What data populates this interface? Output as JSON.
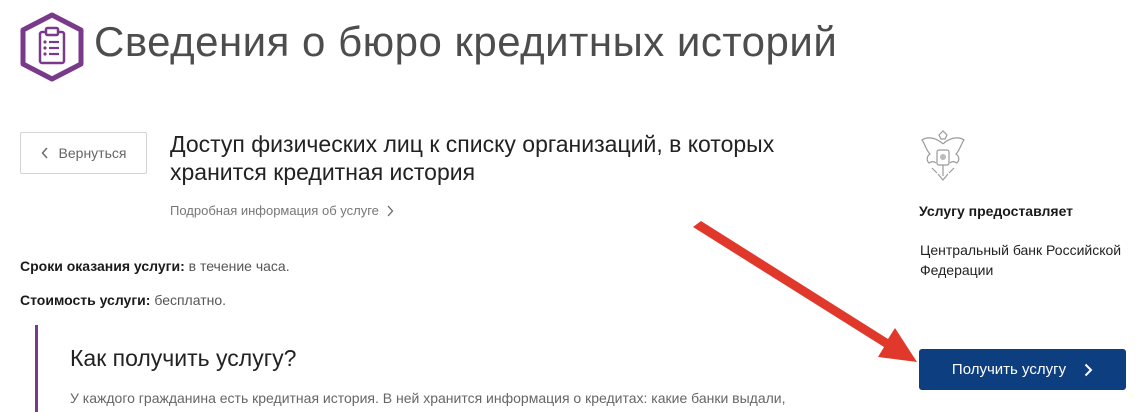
{
  "header": {
    "title": "Сведения о бюро кредитных историй",
    "icon": "clipboard-list-icon",
    "accent_color": "#7a3a8a"
  },
  "navigation": {
    "back_label": "Вернуться"
  },
  "service": {
    "title": "Доступ физических лиц к списку организаций, в которых хранится кредитная история",
    "details_link": "Подробная информация об услуге"
  },
  "facts": {
    "time_label": "Сроки оказания услуги:",
    "time_value": "в течение часа.",
    "cost_label": "Стоимость услуги:",
    "cost_value": "бесплатно."
  },
  "howto": {
    "title": "Как получить услугу?",
    "text": "У каждого гражданина есть кредитная история. В ней хранится информация о кредитах: какие банки выдали,"
  },
  "provider": {
    "emblem_icon": "coat-of-arms-icon",
    "heading": "Услугу предоставляет",
    "name": "Центральный банк Российской Федерации"
  },
  "actions": {
    "get_service_label": "Получить услугу",
    "button_color": "#0d3f80"
  },
  "annotation": {
    "arrow_color": "#e0382b"
  }
}
